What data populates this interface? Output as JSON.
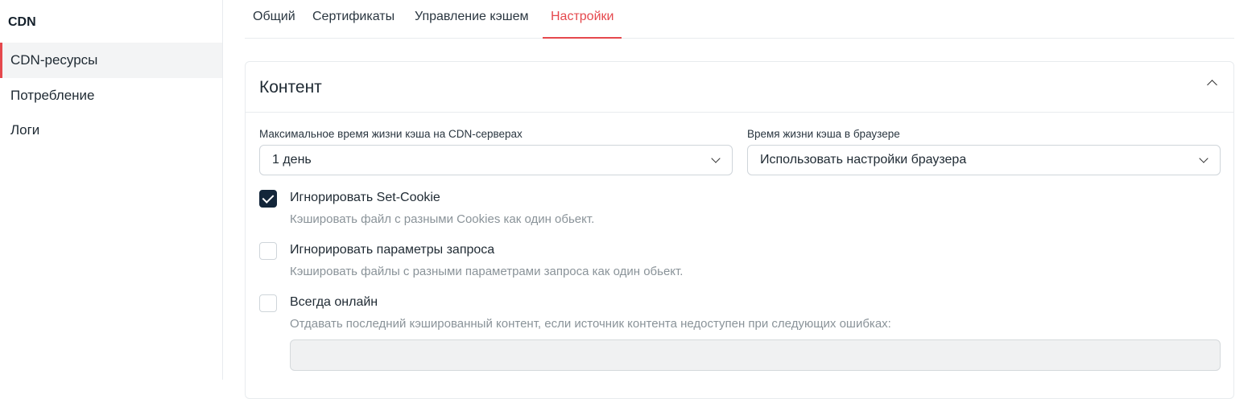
{
  "sidebar": {
    "title": "CDN",
    "items": [
      {
        "label": "CDN-ресурсы",
        "active": true
      },
      {
        "label": "Потребление"
      },
      {
        "label": "Логи"
      }
    ]
  },
  "tabs": [
    {
      "label": "Общий"
    },
    {
      "label": "Сертификаты"
    },
    {
      "label": "Управление кэшем"
    },
    {
      "label": "Настройки",
      "active": true
    }
  ],
  "card": {
    "title": "Контент",
    "cdn_ttl": {
      "label": "Максимальное время жизни кэша на CDN-серверах",
      "value": "1 день"
    },
    "browser_ttl": {
      "label": "Время жизни кэша в браузере",
      "value": "Использовать настройки браузера"
    },
    "options": [
      {
        "title": "Игнорировать Set-Cookie",
        "desc": "Кэшировать файл с разными Cookies как один обьект.",
        "checked": true
      },
      {
        "title": "Игнорировать параметры запроса",
        "desc": "Кэшировать файлы с разными параметрами запроса как один обьект.",
        "checked": false
      },
      {
        "title": "Всегда онлайн",
        "desc": "Отдавать последний кэшированный контент, если источник контента недоступен при следующих ошибках:",
        "checked": false
      }
    ]
  },
  "colors": {
    "accent": "#e5484d",
    "checkbox": "#13263a"
  }
}
